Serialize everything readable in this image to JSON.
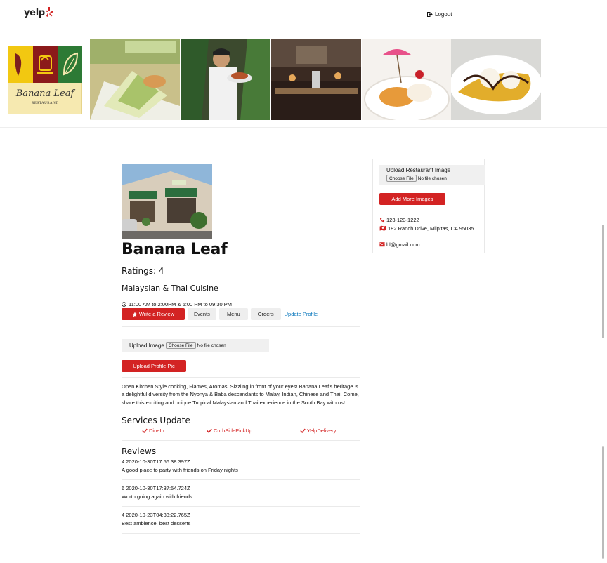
{
  "nav": {
    "brand": "yelp",
    "logout_label": "Logout"
  },
  "logo": {
    "script_text": "Banana Leaf",
    "sub_text": "RESTAURANT"
  },
  "restaurant": {
    "name": "Banana Leaf",
    "ratings": "Ratings: 4",
    "cuisine": "Malaysian & Thai Cuisine",
    "hours": "11:00 AM to 2:00PM & 6:00 PM to 09:30 PM",
    "description": "Open Kitchen Style cooking, Flames, Aromas, Sizzling in front of your eyes! Banana Leaf's heritage is a delightful diversity from the Nyonya & Baba descendants to Malay, Indian, Chinese and Thai. Come, share this exciting and unique Tropical Malaysian and Thai experience in the South Bay with us!"
  },
  "actions": {
    "write_review": "Write a Review",
    "events": "Events",
    "menu": "Menu",
    "orders": "Orders",
    "update_profile": "Update Profile"
  },
  "profile_upload": {
    "label": "Upload Image",
    "choose": "Choose File",
    "no_file": "No file chosen",
    "button": "Upload Profile Pic"
  },
  "services": {
    "title": "Services Update",
    "items": [
      "DineIn",
      "CurbSidePickUp",
      "YelpDelivery"
    ]
  },
  "reviews": {
    "title": "Reviews",
    "items": [
      {
        "meta": "4 2020-10-30T17:56:38.397Z",
        "text": "A good place to party with friends on Friday nights"
      },
      {
        "meta": "6 2020-10-30T17:37:54.724Z",
        "text": "Worth going again with friends"
      },
      {
        "meta": "4 2020-10-23T04:33:22.765Z",
        "text": "Best ambience, best desserts"
      }
    ]
  },
  "side": {
    "upload_label": "Upload Restaurant Image",
    "choose": "Choose File",
    "no_file": "No file chosen",
    "add_images": "Add More Images",
    "phone": "123-123-1222",
    "address": "182 Ranch Drive, Milpitas, CA 95035",
    "email": "bl@gmail.com"
  },
  "colors": {
    "accent": "#d32323",
    "link": "#0073bb",
    "panel": "#f0f0f0"
  },
  "icons": [
    "yelp-burst-icon",
    "logout-icon",
    "clock-icon",
    "star-icon",
    "check-icon",
    "phone-icon",
    "map-icon",
    "email-icon"
  ]
}
